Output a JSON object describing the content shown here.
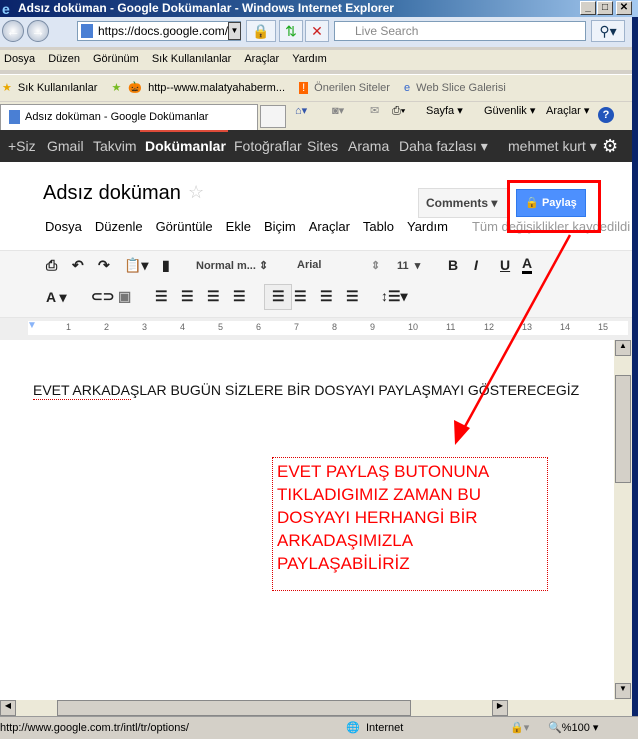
{
  "window": {
    "title": "Adsız doküman - Google Dokümanlar - Windows Internet Explorer"
  },
  "browser": {
    "address": "https://docs.google.com/d",
    "search_placeholder": "Live Search",
    "menu": [
      "Dosya",
      "Düzen",
      "Görünüm",
      "Sık Kullanılanlar",
      "Araçlar",
      "Yardım"
    ],
    "favorites": {
      "label": "Sık Kullanılanlar",
      "link": "http--www.malatyahaberm...",
      "suggested": "Önerilen Siteler",
      "webslice": "Web Slice Galerisi"
    },
    "tab": "Adsız doküman - Google Dokümanlar",
    "commands": {
      "page": "Sayfa",
      "safety": "Güvenlik",
      "tools": "Araçlar"
    }
  },
  "google_bar": {
    "items": [
      "+Siz",
      "Gmail",
      "Takvim",
      "Dokümanlar",
      "Fotoğraflar",
      "Sites",
      "Arama",
      "Daha fazlası ▾"
    ],
    "active": "Dokümanlar",
    "user": "mehmet kurt ▾"
  },
  "doc": {
    "title": "Adsız doküman",
    "comments": "Comments",
    "share": "Paylaş",
    "menu": [
      "Dosya",
      "Düzenle",
      "Görüntüle",
      "Ekle",
      "Biçim",
      "Araçlar",
      "Tablo",
      "Yardım"
    ],
    "save_status": "Tüm değişiklikler kaydedildi",
    "style": "Normal m...",
    "font": "Arial",
    "size": "11",
    "ruler": [
      "1",
      "2",
      "3",
      "4",
      "5",
      "6",
      "7",
      "8",
      "9",
      "10",
      "11",
      "12",
      "13",
      "14",
      "15"
    ],
    "body_text": "EVET ARKADAŞLAR  BUGÜN SİZLERE BİR DOSYAYI PAYLAŞMAYI GÖSTERECEGİZ"
  },
  "annotation": {
    "text": "EVET PAYLAŞ BUTONUNA TIKLADIGIMIZ ZAMAN BU DOSYAYI HERHANGİ BİR ARKADAŞIMIZLA PAYLAŞABİLİRİZ",
    "color": "#ff0000"
  },
  "status": {
    "url": "http://www.google.com.tr/intl/tr/options/",
    "zone": "Internet",
    "zoom": "%100"
  }
}
